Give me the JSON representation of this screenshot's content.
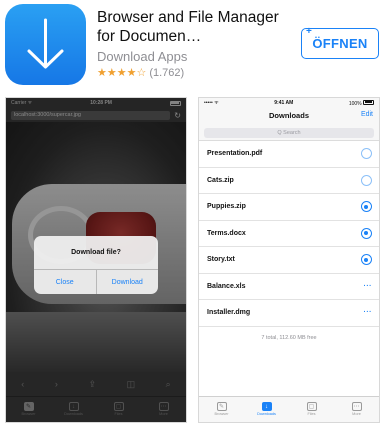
{
  "app": {
    "title": "Browser and File Manager for Documen…",
    "developer": "Download Apps",
    "stars": "★★★★☆",
    "rating_count": "(1.762)",
    "open_label": "ÖFFNEN",
    "open_plus": "+",
    "icon": "download-arrow-icon",
    "accent_color": "#1a82f7"
  },
  "browser_shot": {
    "status": {
      "carrier": "Carrier ᯤ",
      "time": "10:28 PM"
    },
    "url": "localhost:3000/supercar.jpg",
    "reload_icon": "↻",
    "alert": {
      "title": "Download file?",
      "close": "Close",
      "download": "Download"
    },
    "toolbar_icons": [
      "‹",
      "›",
      "⇪",
      "◫",
      "⌕"
    ],
    "tabs": [
      {
        "label": "Browser",
        "icon": "✎",
        "active": true
      },
      {
        "label": "Downloads",
        "icon": "↓",
        "active": false
      },
      {
        "label": "Files",
        "icon": "▢",
        "active": false
      },
      {
        "label": "More",
        "icon": "⋯",
        "active": false
      }
    ]
  },
  "downloads_shot": {
    "status": {
      "carrier": "••••• ᯤ",
      "time": "9:41 AM",
      "battery": "100%"
    },
    "title": "Downloads",
    "edit": "Edit",
    "search_placeholder": "Q  Search",
    "items": [
      {
        "name": "Presentation.pdf",
        "status": "queued"
      },
      {
        "name": "Cats.zip",
        "status": "queued"
      },
      {
        "name": "Puppies.zip",
        "status": "downloading"
      },
      {
        "name": "Terms.docx",
        "status": "downloading"
      },
      {
        "name": "Story.txt",
        "status": "downloading"
      },
      {
        "name": "Balance.xls",
        "status": "done",
        "more": "···"
      },
      {
        "name": "Installer.dmg",
        "status": "done",
        "more": "···"
      }
    ],
    "summary": "7 total, 112.60 MB free",
    "tabs": [
      {
        "label": "Browser",
        "icon": "✎",
        "active": false
      },
      {
        "label": "Downloads",
        "icon": "↓",
        "active": true
      },
      {
        "label": "Files",
        "icon": "▢",
        "active": false
      },
      {
        "label": "More",
        "icon": "⋯",
        "active": false
      }
    ]
  }
}
